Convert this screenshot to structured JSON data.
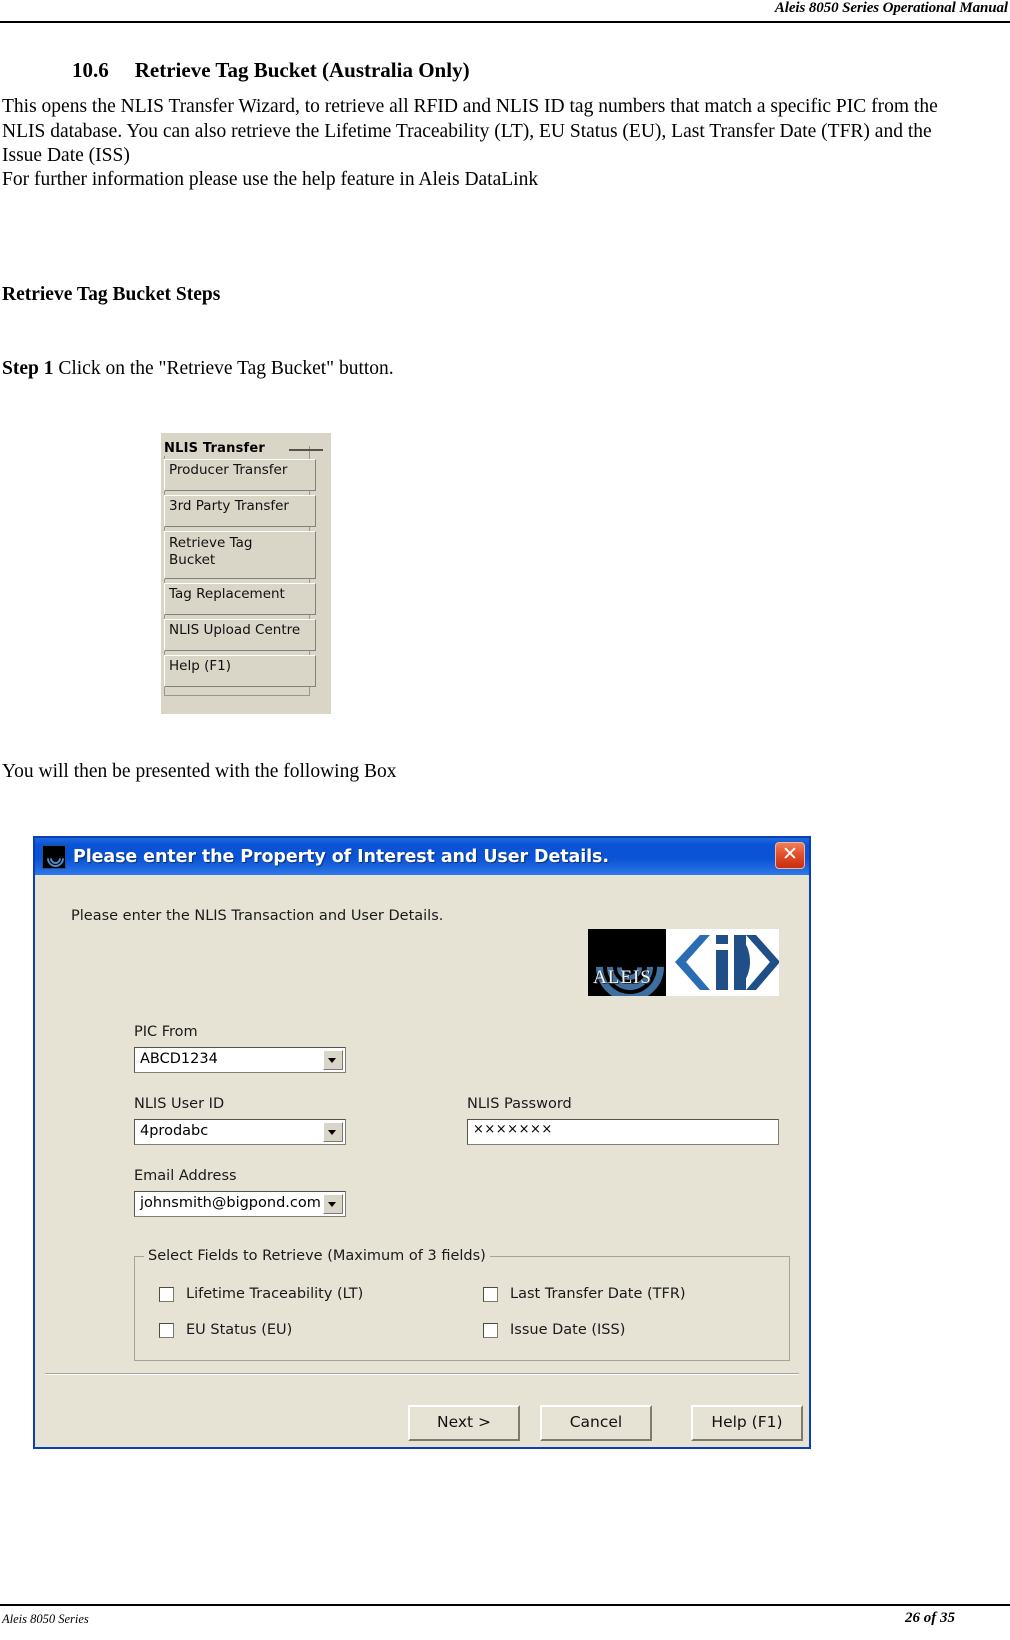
{
  "page": {
    "header_title": "Aleis 8050 Series Operational Manual",
    "footer_left": "Aleis 8050 Series",
    "footer_right": "26 of 35"
  },
  "section": {
    "number": "10.6",
    "title": "Retrieve Tag Bucket (Australia Only)",
    "intro_paragraph": "This opens the NLIS Transfer Wizard, to retrieve all RFID and NLIS ID  tag numbers that match a specific PIC from the NLIS database. You can also retrieve the Lifetime Traceability (LT), EU Status (EU), Last Transfer Date (TFR) and the Issue Date (ISS)",
    "help_paragraph": "For further information please use the help feature in Aleis DataLink",
    "steps_heading": "Retrieve Tag Bucket Steps",
    "step1_bold": "Step 1",
    "step1_text": " Click on the \"Retrieve Tag Bucket\" button.",
    "after_screenshot_text": "You will then be presented with the following Box"
  },
  "nlis_panel": {
    "group_label": "NLIS Transfer",
    "buttons": [
      {
        "label": "Producer Transfer"
      },
      {
        "label": "3rd Party Transfer"
      },
      {
        "label": "Retrieve Tag\nBucket"
      },
      {
        "label": "Tag Replacement"
      },
      {
        "label": "NLIS Upload Centre"
      },
      {
        "label": "Help (F1)"
      }
    ]
  },
  "dialog": {
    "title": "Please enter the Property of Interest and User Details.",
    "close_glyph": "✕",
    "instruction": "Please enter the NLIS Transaction and User Details.",
    "logos": {
      "aleis_wordmark": "ALEIS",
      "nlis_id_mark": "iD"
    },
    "fields": [
      {
        "label": "PIC From",
        "value": "ABCD1234",
        "type": "combobox"
      },
      {
        "label": "NLIS User ID",
        "value": "4prodabc",
        "type": "combobox"
      },
      {
        "label": "NLIS Password",
        "value": "×××××××",
        "type": "password"
      },
      {
        "label": "Email Address",
        "value": "johnsmith@bigpond.com",
        "type": "combobox"
      }
    ],
    "fieldset": {
      "title": "Select Fields to Retrieve (Maximum of 3 fields)",
      "checkboxes": [
        {
          "label": "Lifetime Traceability (LT)",
          "checked": false
        },
        {
          "label": "Last Transfer Date (TFR)",
          "checked": false
        },
        {
          "label": "EU Status (EU)",
          "checked": false
        },
        {
          "label": "Issue Date (ISS)",
          "checked": false
        }
      ]
    },
    "buttons": [
      {
        "label": "Next >"
      },
      {
        "label": "Cancel"
      },
      {
        "label": "Help (F1)"
      }
    ]
  },
  "colors": {
    "titlebar_blue": "#0a53d6",
    "dialog_face": "#e6e3d5",
    "close_red": "#c62e12",
    "logo_blue": "#1f4f86"
  }
}
